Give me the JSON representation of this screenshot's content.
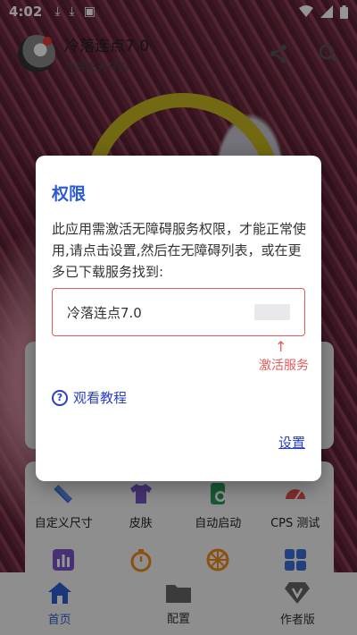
{
  "status_bar": {
    "time": "4:02",
    "icons_left": [
      "download-icon",
      "download-icon",
      "app-icon"
    ],
    "icons_right": [
      "wifi-icon",
      "signal-icon",
      "battery-icon"
    ]
  },
  "header": {
    "title": "冷落连点7.0",
    "subtitle": "冷落天天开心",
    "actions": [
      "share-icon",
      "search-icon"
    ]
  },
  "grid": {
    "row1": [
      {
        "label": "自定义尺寸",
        "icon": "ruler-pencil-icon",
        "color": "#3b6fd8"
      },
      {
        "label": "皮肤",
        "icon": "shirt-icon",
        "color": "#7a55c8"
      },
      {
        "label": "自动启动",
        "icon": "phone-sync-icon",
        "color": "#2e9a5a"
      },
      {
        "label": "CPS 测试",
        "icon": "speedometer-icon",
        "color": "#e05050"
      }
    ],
    "row2": [
      {
        "icon": "bar-chart-icon",
        "color": "#7a55c8"
      },
      {
        "icon": "timer-icon",
        "color": "#f08c1a"
      },
      {
        "icon": "wheel-icon",
        "color": "#f08c1a"
      },
      {
        "icon": "apps-grid-icon",
        "color": "#3b6fd8"
      }
    ]
  },
  "tabbar": {
    "tabs": [
      {
        "label": "首页",
        "icon": "home-icon",
        "active": true
      },
      {
        "label": "配置",
        "icon": "folder-icon",
        "active": false
      },
      {
        "label": "作者版",
        "icon": "vip-diamond-icon",
        "active": false
      }
    ]
  },
  "dialog": {
    "title": "权限",
    "message": "此应用需激活无障碍服务权限，才能正常使用,请点击设置,然后在无障碍列表，或在更多已下载服务找到:",
    "service_name": "冷落连点7.0",
    "arrow": "↑",
    "activate_hint": "激活服务",
    "tutorial_label": "观看教程",
    "help_glyph": "?",
    "settings_label": "设置"
  },
  "colors": {
    "accent": "#2a5bd7",
    "link": "#2a3fc2",
    "warning": "#e05c58"
  }
}
